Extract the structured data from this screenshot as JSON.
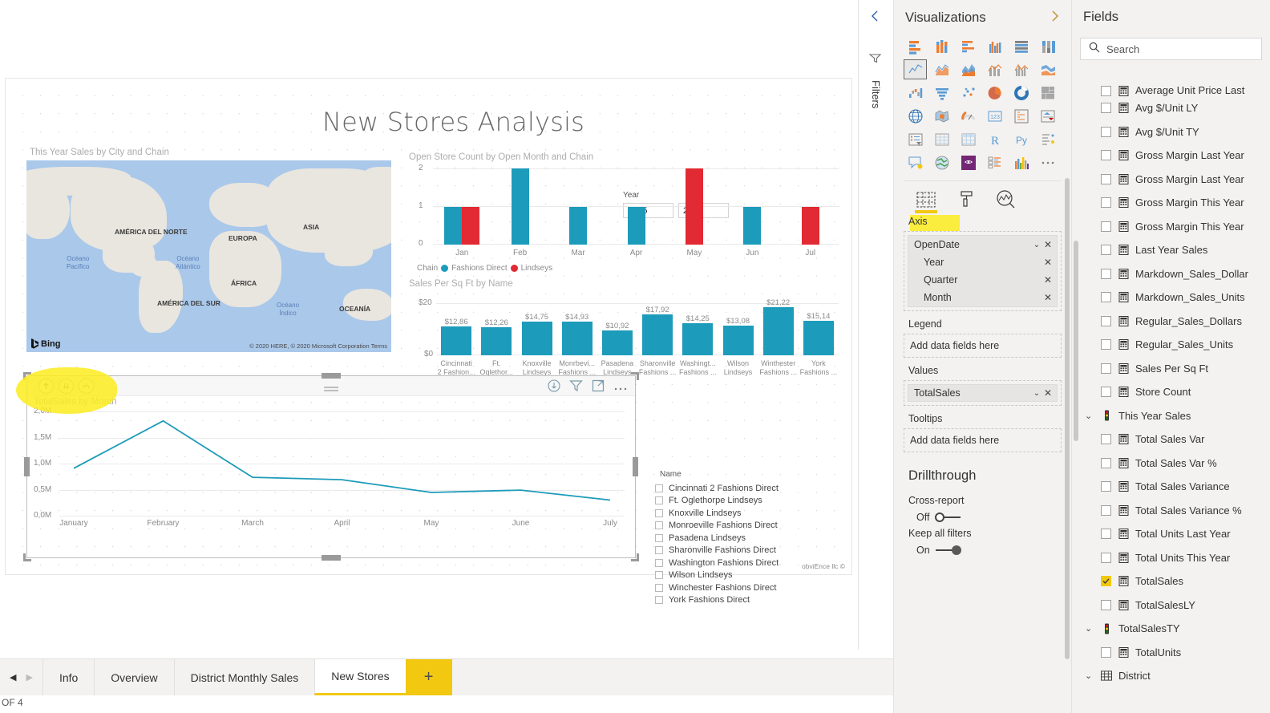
{
  "report": {
    "title": "New Stores Analysis",
    "watermark": "obviEnce llc ©"
  },
  "year_slicer": {
    "label": "Year",
    "from": "2005",
    "to": "2014"
  },
  "map_visual": {
    "title": "This Year Sales by City and Chain",
    "provider": "Bing",
    "attribution": "© 2020 HERE, © 2020 Microsoft Corporation  Terms",
    "continents": [
      "AMÉRICA DEL NORTE",
      "EUROPA",
      "ASIA",
      "ÁFRICA",
      "AMÉRICA DEL SUR",
      "OCEANÍA"
    ],
    "oceans": [
      "Océano Pacífico",
      "Océano Atlántico",
      "Océano Índico"
    ]
  },
  "name_slicer": {
    "title": "Name",
    "items": [
      "Cincinnati 2 Fashions Direct",
      "Ft. Oglethorpe Lindseys",
      "Knoxville Lindseys",
      "Monroeville Fashions Direct",
      "Pasadena Lindseys",
      "Sharonville Fashions Direct",
      "Washington Fashions Direct",
      "Wilson Lindseys",
      "Winchester Fashions Direct",
      "York Fashions Direct"
    ]
  },
  "chart_data": [
    {
      "type": "bar",
      "title": "Open Store Count by Open Month and Chain",
      "xlabel": "",
      "ylabel": "",
      "categories": [
        "Jan",
        "Feb",
        "Mar",
        "Apr",
        "May",
        "Jun",
        "Jul"
      ],
      "ylim": [
        0,
        2
      ],
      "yticks": [
        "0",
        "1",
        "2"
      ],
      "grid": true,
      "legend_title": "Chain",
      "legend_position": "bottom",
      "series": [
        {
          "name": "Fashions Direct",
          "color": "#1d9bba",
          "values": [
            1,
            2,
            1,
            1,
            0,
            1,
            0
          ]
        },
        {
          "name": "Lindseys",
          "color": "#e12a33",
          "values": [
            1,
            0,
            0,
            0,
            2,
            0,
            1
          ]
        }
      ]
    },
    {
      "type": "bar",
      "title": "Sales Per Sq Ft by Name",
      "xlabel": "",
      "ylabel": "",
      "ylim": [
        0,
        23
      ],
      "yticks": [
        "$0",
        "$20"
      ],
      "grid": true,
      "color": "#1d9bba",
      "categories": [
        "Cincinnati\n2 Fashion...",
        "Ft.\nOglethor...",
        "Knoxville\nLindseys",
        "Monrbevi...\nFashions ...",
        "Pasadena\nLindseys",
        "Sharonville\nFashions ...",
        "Washingt...\nFashions ...",
        "Wilson\nLindseys",
        "Winthester\nFashions ...",
        "York\nFashions ..."
      ],
      "values": [
        12.86,
        12.26,
        14.75,
        14.93,
        10.92,
        17.92,
        14.25,
        13.08,
        21.22,
        15.14
      ],
      "data_labels": [
        "$12,86",
        "$12,26",
        "$14,75",
        "$14,93",
        "$10,92",
        "$17,92",
        "$14,25",
        "$13,08",
        "$21,22",
        "$15,14"
      ]
    },
    {
      "type": "line",
      "title": "TotalSales by Month",
      "xlabel": "",
      "ylabel": "",
      "color": "#1d9bba",
      "grid": true,
      "ylim": [
        0,
        2200000
      ],
      "yticks": [
        "0,0M",
        "0,5M",
        "1,0M",
        "1,5M",
        "2,0M"
      ],
      "categories": [
        "January",
        "February",
        "March",
        "April",
        "May",
        "June",
        "July"
      ],
      "values": [
        1000000,
        2000000,
        810000,
        760000,
        490000,
        540000,
        330000
      ]
    }
  ],
  "line_visual_toolbar": {
    "drill_up": "drill-up",
    "drill_down": "drill-down",
    "expand_hierarchy": "expand-all-down",
    "icons": [
      "drill-mode",
      "filter",
      "focus-mode",
      "more-options"
    ]
  },
  "filters_rail": {
    "label": "Filters"
  },
  "visualizations": {
    "title": "Visualizations",
    "expand_icon": "›",
    "icons": [
      "stacked-bar-chart",
      "stacked-column-chart",
      "clustered-bar-chart",
      "clustered-column-chart",
      "100-stacked-bar-chart",
      "100-stacked-column-chart",
      "line-chart",
      "area-chart",
      "stacked-area-chart",
      "line-and-stacked-column-chart",
      "line-and-clustered-column-chart",
      "ribbon-chart",
      "waterfall-chart",
      "funnel-chart",
      "scatter-chart",
      "pie-chart",
      "donut-chart",
      "treemap",
      "map",
      "filled-map",
      "gauge",
      "card",
      "multi-row-card",
      "kpi",
      "slicer",
      "table",
      "matrix",
      "r-script-visual",
      "python-visual",
      "key-influencers",
      "smart-narrative",
      "arcgis-map",
      "powerapps-visual",
      "decomposition-tree",
      "paginated-report",
      "more-visuals"
    ],
    "tool_tabs": [
      "fields-pane",
      "format-pane",
      "analytics-pane"
    ],
    "buckets": {
      "axis": {
        "label": "Axis",
        "group": "OpenDate",
        "children": [
          "Year",
          "Quarter",
          "Month"
        ]
      },
      "legend": {
        "label": "Legend",
        "placeholder": "Add data fields here"
      },
      "values": {
        "label": "Values",
        "field": "TotalSales"
      },
      "tooltips": {
        "label": "Tooltips",
        "placeholder": "Add data fields here"
      }
    },
    "drillthrough": {
      "title": "Drillthrough",
      "cross_report": {
        "label": "Cross-report",
        "state": "Off"
      },
      "keep_all_filters": {
        "label": "Keep all filters",
        "state": "On"
      }
    }
  },
  "fields": {
    "title": "Fields",
    "search_placeholder": "Search",
    "items": [
      {
        "label": "Average Unit Price Last",
        "type": "measure",
        "checked": false,
        "partial": true
      },
      {
        "label": "Avg $/Unit LY",
        "type": "measure",
        "checked": false
      },
      {
        "label": "Avg $/Unit TY",
        "type": "measure",
        "checked": false
      },
      {
        "label": "Gross Margin Last Year",
        "type": "measure",
        "checked": false
      },
      {
        "label": "Gross Margin Last Year",
        "type": "measure",
        "checked": false
      },
      {
        "label": "Gross Margin This Year",
        "type": "measure",
        "checked": false
      },
      {
        "label": "Gross Margin This Year",
        "type": "measure",
        "checked": false
      },
      {
        "label": "Last Year Sales",
        "type": "measure",
        "checked": false
      },
      {
        "label": "Markdown_Sales_Dollar",
        "type": "measure",
        "checked": false
      },
      {
        "label": "Markdown_Sales_Units",
        "type": "measure",
        "checked": false
      },
      {
        "label": "Regular_Sales_Dollars",
        "type": "measure",
        "checked": false
      },
      {
        "label": "Regular_Sales_Units",
        "type": "measure",
        "checked": false
      },
      {
        "label": "Sales Per Sq Ft",
        "type": "measure",
        "checked": false
      },
      {
        "label": "Store Count",
        "type": "measure",
        "checked": false
      },
      {
        "label": "This Year Sales",
        "type": "kpi-group",
        "expanded": true
      },
      {
        "label": "Total Sales Var",
        "type": "measure",
        "checked": false
      },
      {
        "label": "Total Sales Var %",
        "type": "measure",
        "checked": false
      },
      {
        "label": "Total Sales Variance",
        "type": "measure",
        "checked": false
      },
      {
        "label": "Total Sales Variance %",
        "type": "measure",
        "checked": false
      },
      {
        "label": "Total Units Last Year",
        "type": "measure",
        "checked": false
      },
      {
        "label": "Total Units This Year",
        "type": "measure",
        "checked": false
      },
      {
        "label": "TotalSales",
        "type": "measure",
        "checked": true
      },
      {
        "label": "TotalSalesLY",
        "type": "measure",
        "checked": false
      },
      {
        "label": "TotalSalesTY",
        "type": "kpi-group",
        "expanded": true
      },
      {
        "label": "TotalUnits",
        "type": "measure",
        "checked": false
      },
      {
        "label": "District",
        "type": "table-group",
        "expanded": true
      }
    ]
  },
  "tabbar": {
    "tabs": [
      "Info",
      "Overview",
      "District Monthly Sales",
      "New Stores"
    ],
    "active": "New Stores",
    "add_label": "+",
    "page_count": "OF 4"
  },
  "colors": {
    "accent": "#f2c811",
    "series_blue": "#1d9bba",
    "series_red": "#e12a33",
    "highlight": "#fbec1e"
  }
}
